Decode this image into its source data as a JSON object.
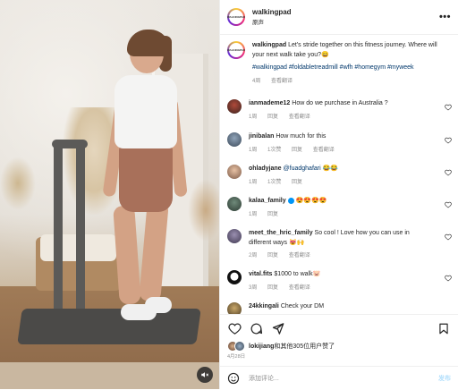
{
  "header": {
    "username": "walkingpad",
    "subtitle": "原声",
    "avatar_text": "WALKINGPAD",
    "more_icon": "•••"
  },
  "caption": {
    "username": "walkingpad",
    "text": "Let's stride together on this fitness journey. Where will your next walk take you?😄",
    "tags": "#walkingpad #foldabletreadmill #wfh #homegym #myweek",
    "time": "4周",
    "translate": "查看翻译"
  },
  "comments": [
    {
      "username": "ianmademe12",
      "text": "How do we purchase in Australia ?",
      "time": "1周",
      "likes": "",
      "reply": "回复",
      "translate": "查看翻译"
    },
    {
      "username": "jinibalan",
      "text": "How much for this",
      "time": "1周",
      "likes": "1次赞",
      "reply": "回复",
      "translate": "查看翻译"
    },
    {
      "username": "ohladyjane",
      "mention": "@fuadghafari",
      "text": "😂😂",
      "time": "1周",
      "likes": "1次赞",
      "reply": "回复",
      "translate": ""
    },
    {
      "username": "kalaa_family",
      "text": "😍😍😍😍",
      "time": "1周",
      "likes": "",
      "reply": "回复",
      "translate": ""
    },
    {
      "username": "meet_the_hric_family",
      "text": "So cool ! Love how you can use in different ways 😻🙌",
      "time": "2周",
      "likes": "",
      "reply": "回复",
      "translate": "查看翻译"
    },
    {
      "username": "vital.fits",
      "text": "$1000 to walk🐷",
      "time": "3周",
      "likes": "",
      "reply": "回复",
      "translate": "查看翻译"
    },
    {
      "username": "24kkingali",
      "text": "Check your DM",
      "time": "",
      "likes": "",
      "reply": "",
      "translate": ""
    }
  ],
  "likes_line": {
    "user": "lokijiang",
    "rest": "和其他305位用户赞了"
  },
  "date": "4月28日",
  "composer": {
    "placeholder": "添加评论...",
    "post_label": "发布"
  },
  "colors": {
    "accent": "#0095f6",
    "link": "#00376b",
    "muted": "#8e8e8e",
    "emoji_red": "#ed4956"
  }
}
